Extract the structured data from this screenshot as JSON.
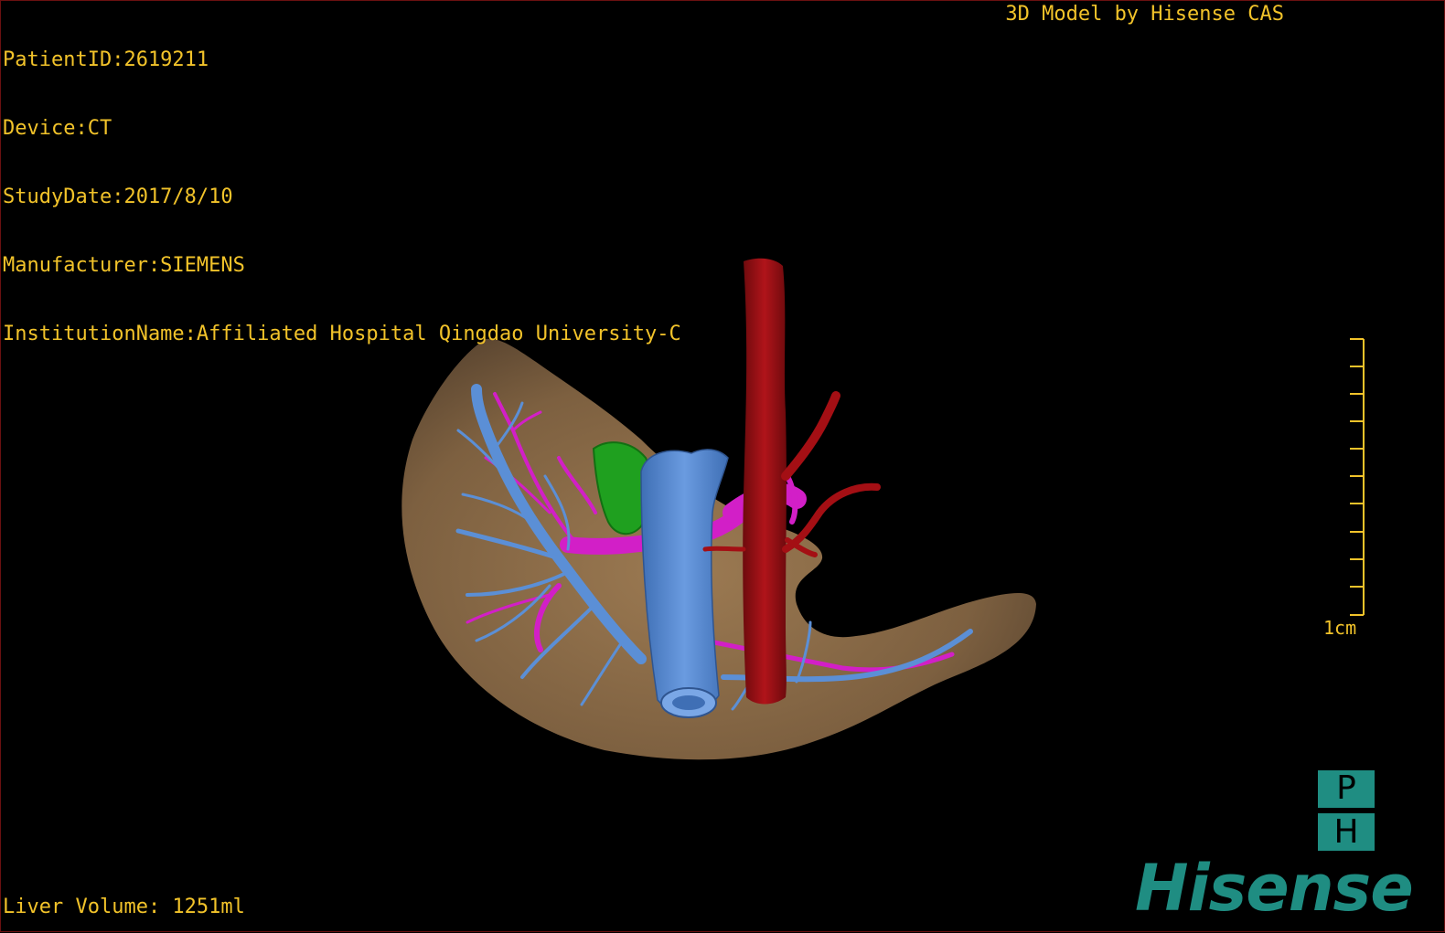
{
  "header": {
    "patient_id": "PatientID:2619211",
    "device": "Device:CT",
    "study_date": "StudyDate:2017/8/10",
    "manufacturer": "Manufacturer:SIEMENS",
    "institution": "InstitutionName:Affiliated Hospital Qingdao University-C",
    "credit": "3D Model by Hisense CAS"
  },
  "footer": {
    "liver_volume": "Liver Volume: 1251ml"
  },
  "scale": {
    "label": "1cm"
  },
  "logo": {
    "badge_top": "P",
    "badge_bottom": "H",
    "brand": "Hisense"
  },
  "colors": {
    "text": "#f2c32a",
    "liver": "#8b6b46",
    "hepatic_vein": "#5b8fd6",
    "portal_vein": "#d21fc7",
    "artery": "#a40f14",
    "gallbladder": "#1fa01f",
    "brand": "#1f8d82"
  },
  "icons": {
    "badge": "ph-logo-icon"
  }
}
